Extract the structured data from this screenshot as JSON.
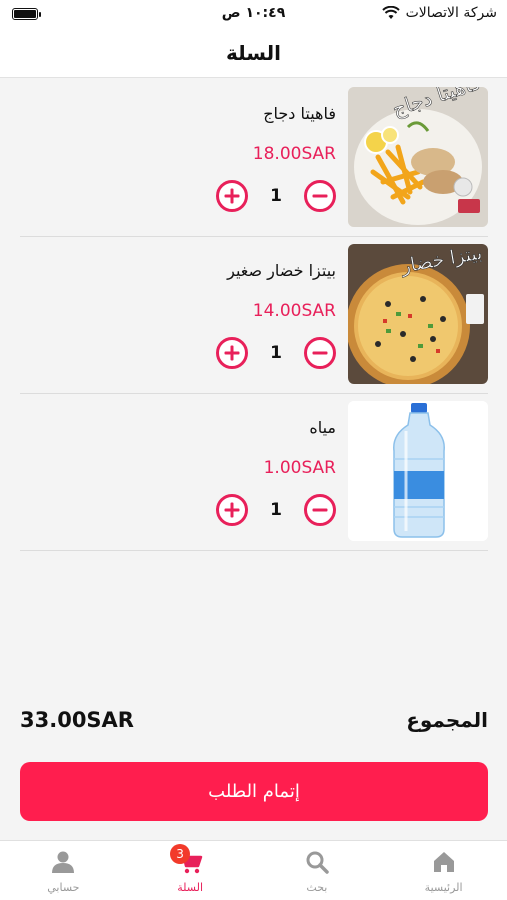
{
  "status_bar": {
    "carrier": "شركة الاتصالات",
    "time": "١٠:٤٩ ص"
  },
  "header": {
    "title": "السلة"
  },
  "cart": {
    "items": [
      {
        "name": "فاهيتا دجاج",
        "price": "18.00SAR",
        "quantity": "1",
        "image": "fajita-chicken-photo"
      },
      {
        "name": "بيتزا خضار صغير",
        "price": "14.00SAR",
        "quantity": "1",
        "image": "veggie-pizza-photo"
      },
      {
        "name": "مياه",
        "price": "1.00SAR",
        "quantity": "1",
        "image": "water-bottle-photo"
      }
    ]
  },
  "total": {
    "label": "المجموع",
    "amount": "33.00SAR"
  },
  "checkout_label": "إتمام الطلب",
  "tab_bar": {
    "items": [
      {
        "label": "الرئيسية",
        "icon": "home-icon"
      },
      {
        "label": "بحث",
        "icon": "search-icon"
      },
      {
        "label": "السلة",
        "icon": "cart-icon",
        "badge": "3"
      },
      {
        "label": "حسابي",
        "icon": "user-icon"
      }
    ],
    "active_color": "#e8205a",
    "inactive_color": "#999999"
  },
  "colors": {
    "accent": "#e8205a",
    "checkout": "#ff1e4e"
  }
}
